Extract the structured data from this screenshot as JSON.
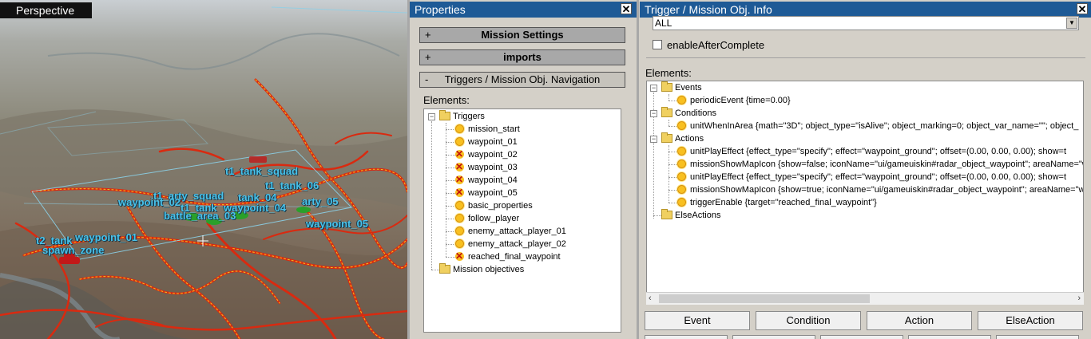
{
  "viewport": {
    "mode_label": "Perspective",
    "labels": [
      "t1_tank_squad",
      "t1_tank_06",
      "t1_arty_squad",
      "tank_04",
      "waypoint_02",
      "t1_tank",
      "waypoint_04",
      "arty_05",
      "battle_area_03",
      "waypoint_05",
      "t2_tank",
      "waypoint_01",
      "spawn_zone"
    ]
  },
  "properties": {
    "title": "Properties",
    "sections": [
      {
        "label": "Mission Settings",
        "toggle": "+"
      },
      {
        "label": "imports",
        "toggle": "+"
      },
      {
        "label": "Triggers / Mission Obj. Navigation",
        "toggle": "-"
      }
    ],
    "elements_label": "Elements:",
    "tree": {
      "triggers_folder": "Triggers",
      "items": [
        {
          "label": "mission_start",
          "icon": "sun-icon"
        },
        {
          "label": "waypoint_01",
          "icon": "sun-icon"
        },
        {
          "label": "waypoint_02",
          "icon": "disabled-x-icon"
        },
        {
          "label": "waypoint_03",
          "icon": "disabled-x-icon"
        },
        {
          "label": "waypoint_04",
          "icon": "disabled-x-icon"
        },
        {
          "label": "waypoint_05",
          "icon": "disabled-x-icon"
        },
        {
          "label": "basic_properties",
          "icon": "sun-icon"
        },
        {
          "label": "follow_player",
          "icon": "sun-icon"
        },
        {
          "label": "enemy_attack_player_01",
          "icon": "sun-icon"
        },
        {
          "label": "enemy_attack_player_02",
          "icon": "sun-icon"
        },
        {
          "label": "reached_final_waypoint",
          "icon": "disabled-x-icon"
        }
      ],
      "objectives_folder": "Mission objectives"
    }
  },
  "info": {
    "title": "Trigger / Mission Obj. Info",
    "dropdown_value": "ALL",
    "checkbox_label": "enableAfterComplete",
    "elements_label": "Elements:",
    "tree": {
      "events_folder": "Events",
      "events": [
        "periodicEvent {time=0.00}"
      ],
      "conditions_folder": "Conditions",
      "conditions": [
        "unitWhenInArea {math=\"3D\"; object_type=\"isAlive\"; object_marking=0; object_var_name=\"\"; object_"
      ],
      "actions_folder": "Actions",
      "actions": [
        "unitPlayEffect {effect_type=\"specify\"; effect=\"waypoint_ground\"; offset=(0.00, 0.00, 0.00); show=t",
        "missionShowMapIcon {show=false; iconName=\"ui/gameuiskin#radar_object_waypoint\"; areaName=\"w",
        "unitPlayEffect {effect_type=\"specify\"; effect=\"waypoint_ground\"; offset=(0.00, 0.00, 0.00); show=t",
        "missionShowMapIcon {show=true; iconName=\"ui/gameuiskin#radar_object_waypoint\"; areaName=\"wa",
        "triggerEnable {target=\"reached_final_waypoint\"}"
      ],
      "else_folder": "ElseActions"
    },
    "buttons": [
      "Event",
      "Condition",
      "Action",
      "ElseAction"
    ]
  },
  "colors": {
    "titlebar": "#1e5a96",
    "label_cyan": "#49c2ea",
    "road_red": "#d92a10",
    "road_yellow": "#f2c21a",
    "unit_green": "#2aa02a",
    "unit_red": "#c21818"
  }
}
